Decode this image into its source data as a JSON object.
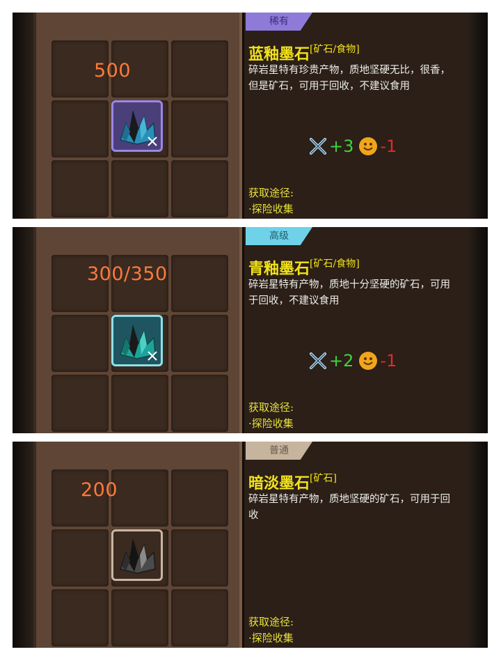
{
  "cards": [
    {
      "price": "500",
      "rarity": {
        "label": "稀有",
        "color": "#8e7bd9"
      },
      "frame_color": "#9b86e6",
      "crystal_color": "#2a8fb8",
      "name": "蓝釉墨石",
      "category": "[矿石/食物]",
      "description": "碎岩星特有珍贵产物，质地坚硬无比，很香，但是矿石，可用于回收，不建议食用",
      "effects": {
        "food_icon": "fork-spoon-icon",
        "food_value": "+3",
        "mood_icon": "smile-icon",
        "mood_value": "-1"
      },
      "acquire_title": "获取途径:",
      "acquire_method": "·探险收集"
    },
    {
      "price": "300/350",
      "rarity": {
        "label": "高级",
        "color": "#6fd2e8"
      },
      "frame_color": "#8fe0ea",
      "crystal_color": "#1ea39a",
      "name": "青釉墨石",
      "category": "[矿石/食物]",
      "description": "碎岩星特有产物，质地十分坚硬的矿石，可用于回收，不建议食用",
      "effects": {
        "food_icon": "fork-spoon-icon",
        "food_value": "+2",
        "mood_icon": "smile-icon",
        "mood_value": "-1"
      },
      "acquire_title": "获取途径:",
      "acquire_method": "·探险收集"
    },
    {
      "price": "200",
      "rarity": {
        "label": "普通",
        "color": "#c7b49e"
      },
      "frame_color": "#c9b7a2",
      "crystal_color": "#4a4a4a",
      "name": "暗淡墨石",
      "category": "[矿石]",
      "description": "碎岩星特有产物，质地坚硬的矿石，可用于回收",
      "effects": null,
      "acquire_title": "获取途径:",
      "acquire_method": "·探险收集"
    }
  ]
}
